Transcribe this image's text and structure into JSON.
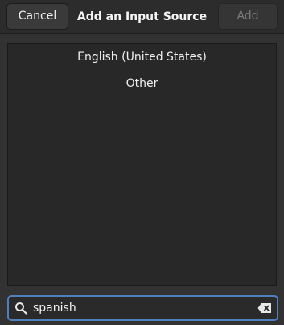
{
  "header": {
    "cancel_label": "Cancel",
    "title": "Add an Input Source",
    "add_label": "Add"
  },
  "list": {
    "items": [
      {
        "label": "English (United States)"
      },
      {
        "label": "Other"
      }
    ]
  },
  "search": {
    "value": "spanish",
    "icon": "search-icon",
    "clear_icon": "clear-icon"
  },
  "colors": {
    "focus_border": "#4f7ec1",
    "background": "#323232"
  }
}
